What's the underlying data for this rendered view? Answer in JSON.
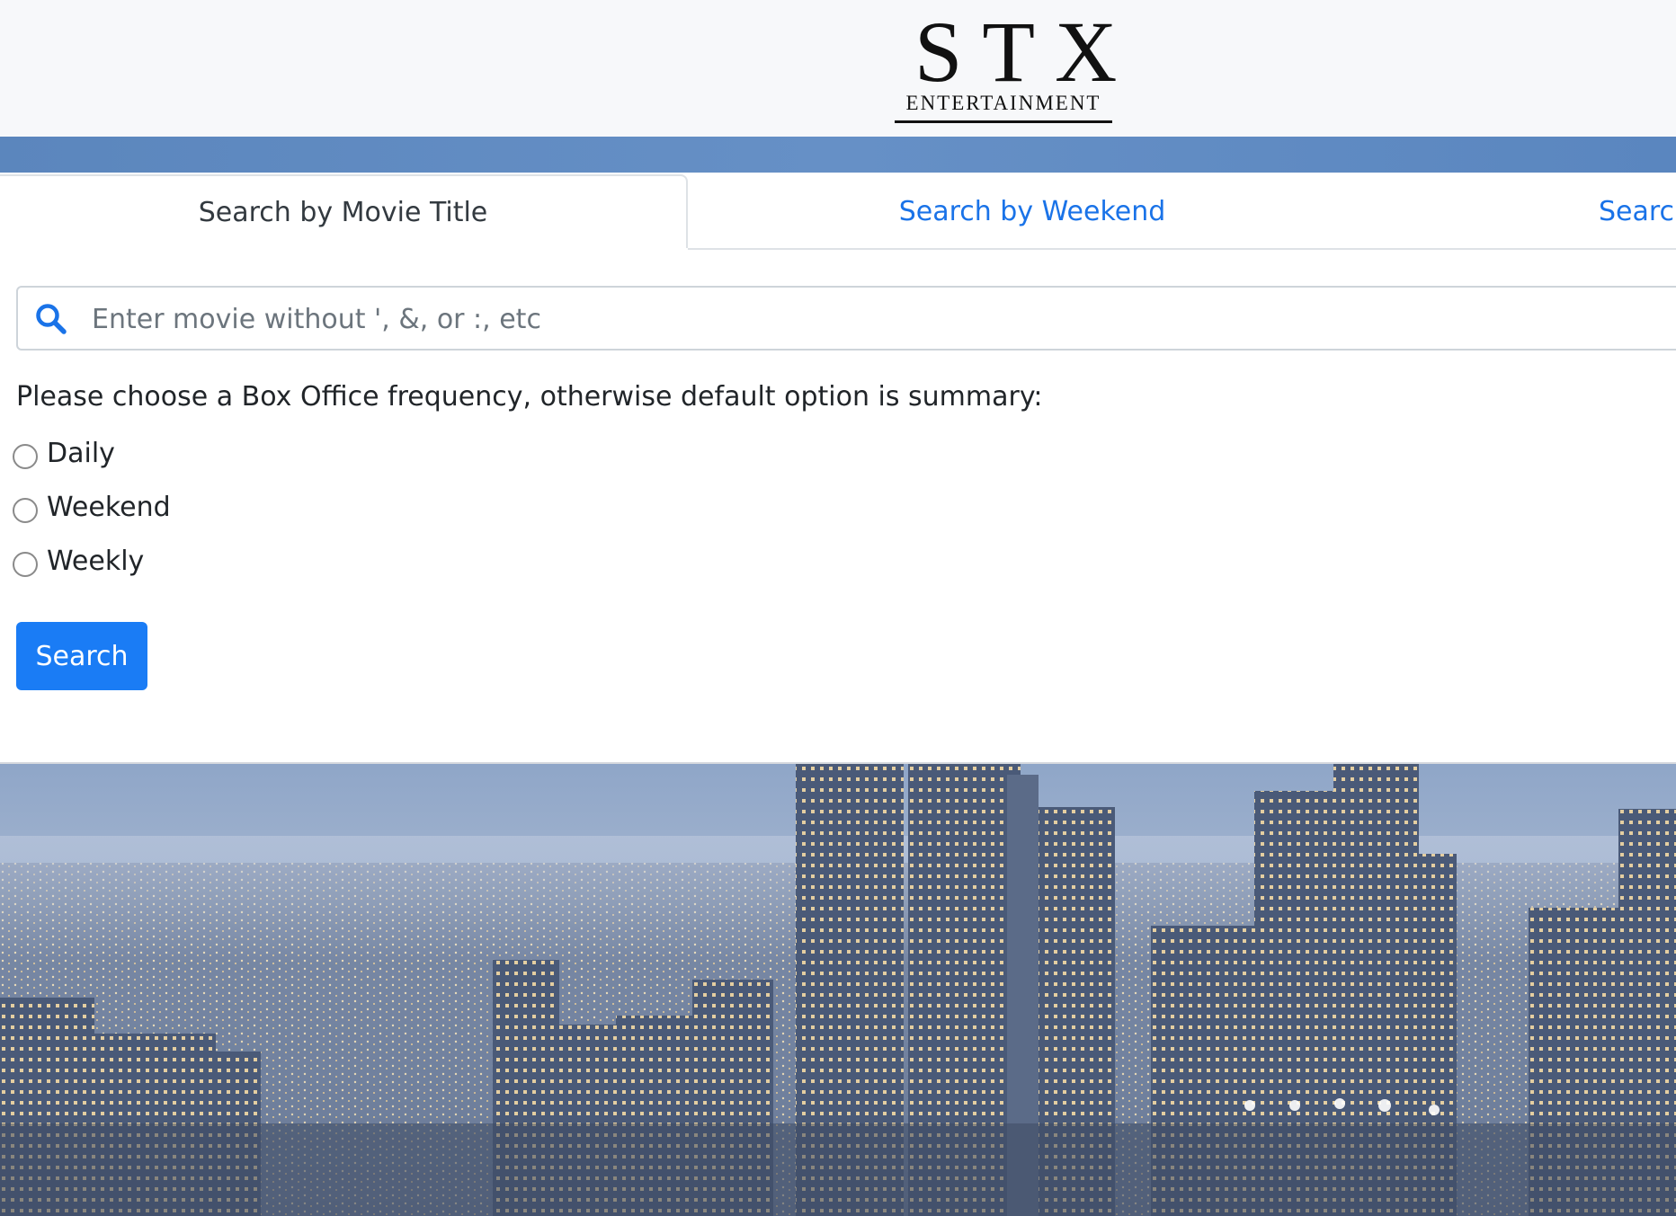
{
  "header": {
    "logo_main": "STX",
    "logo_sub": "ENTERTAINMENT"
  },
  "tabs": [
    {
      "label": "Search by Movie Title",
      "active": true
    },
    {
      "label": "Search by Weekend",
      "active": false
    },
    {
      "label": "Search",
      "active": false
    }
  ],
  "search": {
    "placeholder": "Enter movie without ', &, or :, etc",
    "value": ""
  },
  "frequency": {
    "prompt": "Please choose a Box Office frequency, otherwise default option is summary:",
    "options": [
      {
        "label": "Daily",
        "selected": false
      },
      {
        "label": "Weekend",
        "selected": false
      },
      {
        "label": "Weekly",
        "selected": false
      }
    ]
  },
  "actions": {
    "search_label": "Search"
  },
  "colors": {
    "accent": "#1a7cf5",
    "link": "#1a73e8",
    "band": "#5b86bd"
  }
}
